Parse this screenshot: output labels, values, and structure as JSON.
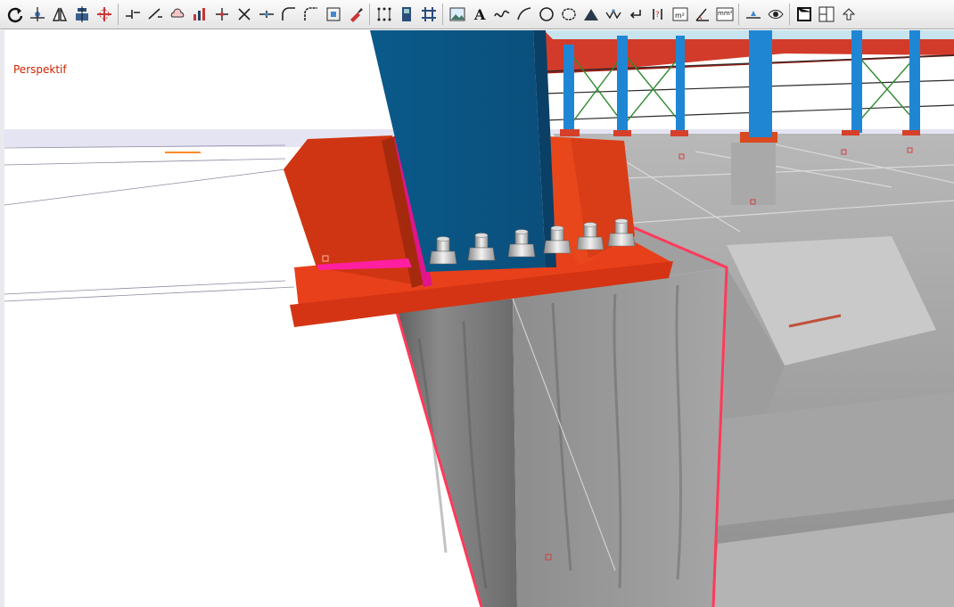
{
  "viewport": {
    "view_label": "Perspektif"
  },
  "toolbar": {
    "groups": [
      [
        "refresh-icon",
        "point-snap-icon",
        "mirror-icon",
        "align-icon",
        "move-grid-icon"
      ],
      [
        "break-line-icon",
        "extend-line-icon",
        "cloud-icon",
        "column-chart-icon",
        "intersect-icon",
        "cross-icon",
        "split-icon",
        "arc-icon",
        "fillet-icon",
        "select-box-icon",
        "brush-icon"
      ],
      [
        "grid-points-icon",
        "door-icon",
        "hash-grid-icon"
      ],
      [
        "image-icon",
        "text-icon",
        "spline-icon",
        "arc-line-icon",
        "circle-icon",
        "cloud-shape-icon",
        "slope-icon",
        "polyline-icon",
        "return-icon",
        "measure-icon",
        "area-m2-icon",
        "angle-measure-icon",
        "area-mm2-icon"
      ],
      [
        "elevation-icon",
        "eye-view-icon"
      ],
      [
        "box-view-icon",
        "layout-icon",
        "more-icon"
      ]
    ],
    "texts": {
      "area_m2": "m²",
      "area_mm2": "mm²",
      "text_tool": "A"
    }
  }
}
